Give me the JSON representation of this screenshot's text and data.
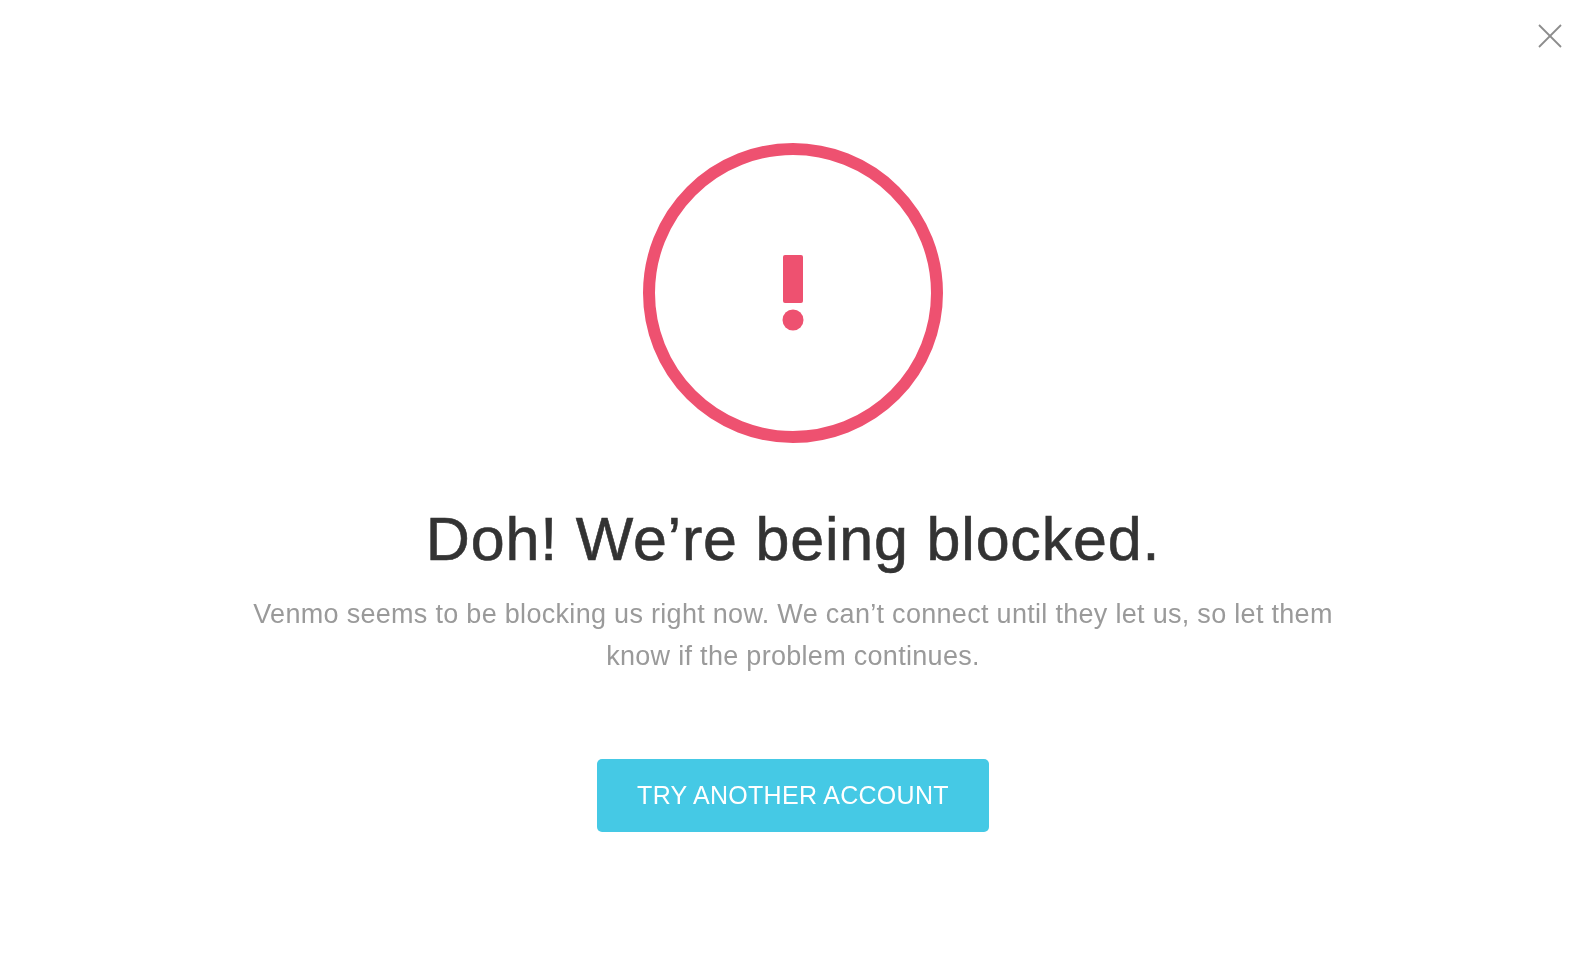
{
  "alert": {
    "title": "Doh! We’re being blocked.",
    "message": "Venmo seems to be blocking us right now. We can’t connect until they let us, so let them know if the problem continues.",
    "button": {
      "label": "TRY ANOTHER ACCOUNT"
    }
  }
}
